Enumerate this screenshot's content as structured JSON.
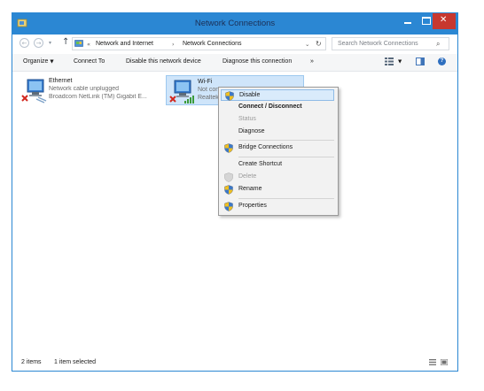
{
  "window": {
    "title": "Network Connections",
    "accent_color": "#2b87d3"
  },
  "address_bar": {
    "overflow_chevron": "«",
    "breadcrumb": [
      "Network and Internet",
      "Network Connections"
    ],
    "separator": "›",
    "search_placeholder": "Search Network Connections"
  },
  "command_bar": {
    "organize": "Organize",
    "connect_to": "Connect To",
    "disable_device": "Disable this network device",
    "diagnose": "Diagnose this connection",
    "more": "»"
  },
  "connections": [
    {
      "name": "Ethernet",
      "status": "Network cable unplugged",
      "adapter": "Broadcom NetLink (TM) Gigabit E...",
      "icon": "ethernet-icon",
      "selected": false
    },
    {
      "name": "Wi-Fi",
      "status": "Not con",
      "adapter": "Realtek",
      "icon": "wifi-signal-icon",
      "selected": true
    }
  ],
  "context_menu": {
    "items": [
      {
        "label": "Disable",
        "shield": true,
        "bold": false,
        "disabled": false,
        "hover": true
      },
      {
        "label": "Connect / Disconnect",
        "shield": false,
        "bold": true,
        "disabled": false
      },
      {
        "label": "Status",
        "shield": false,
        "bold": false,
        "disabled": true
      },
      {
        "label": "Diagnose",
        "shield": false,
        "bold": false,
        "disabled": false
      },
      {
        "label": "Bridge Connections",
        "shield": true,
        "bold": false,
        "disabled": false
      },
      {
        "label": "Create Shortcut",
        "shield": false,
        "bold": false,
        "disabled": false
      },
      {
        "label": "Delete",
        "shield": true,
        "bold": false,
        "disabled": true
      },
      {
        "label": "Rename",
        "shield": true,
        "bold": false,
        "disabled": false
      },
      {
        "label": "Properties",
        "shield": true,
        "bold": false,
        "disabled": false
      }
    ]
  },
  "status_bar": {
    "item_count": "2 items",
    "selection": "1 item selected"
  }
}
